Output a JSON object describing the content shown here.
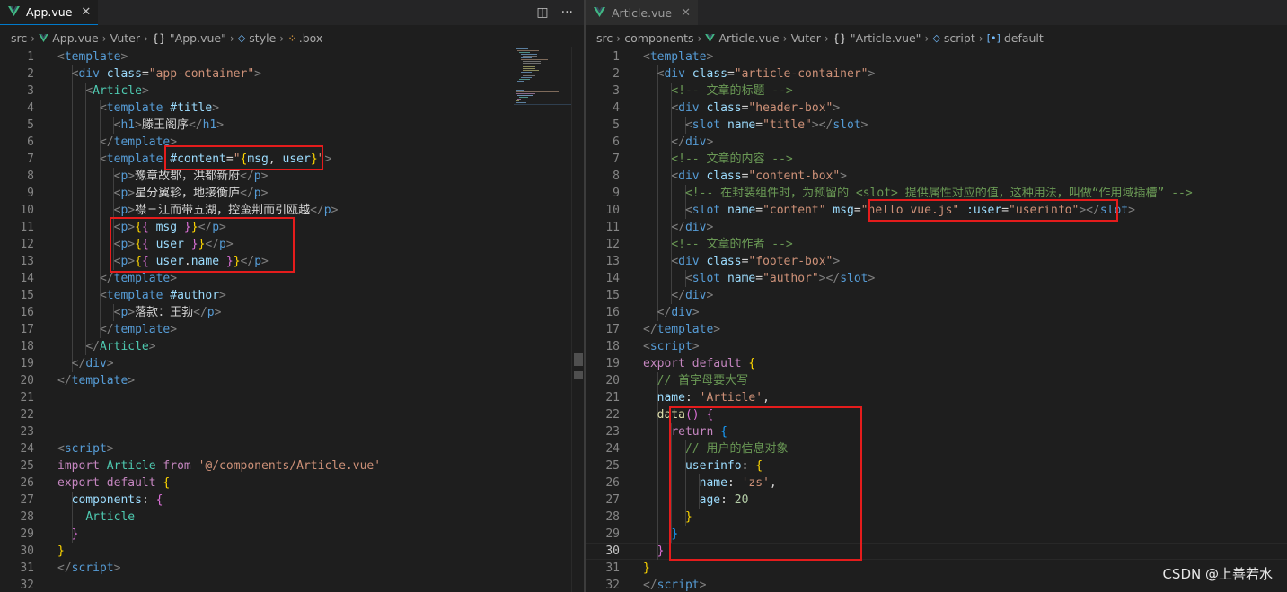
{
  "left_editor": {
    "tab": {
      "label": "App.vue",
      "close": "✕"
    },
    "actions": {
      "split": "◫",
      "more": "···"
    },
    "breadcrumb": [
      "src",
      "App.vue",
      "Vuter",
      "\"App.vue\"",
      "style",
      ".box"
    ],
    "lines": [
      [
        [
          "t",
          "<"
        ],
        [
          "tg",
          "template"
        ],
        [
          "t",
          ">"
        ]
      ],
      [
        [
          "tx",
          "  "
        ],
        [
          "t",
          "<"
        ],
        [
          "tg",
          "div"
        ],
        [
          "tx",
          " "
        ],
        [
          "at",
          "class"
        ],
        [
          "tx",
          "="
        ],
        [
          "st",
          "\"app-container\""
        ],
        [
          "t",
          ">"
        ]
      ],
      [
        [
          "tx",
          "    "
        ],
        [
          "t",
          "<"
        ],
        [
          "cl",
          "Article"
        ],
        [
          "t",
          ">"
        ]
      ],
      [
        [
          "tx",
          "      "
        ],
        [
          "t",
          "<"
        ],
        [
          "tg",
          "template"
        ],
        [
          "tx",
          " "
        ],
        [
          "at",
          "#title"
        ],
        [
          "t",
          ">"
        ]
      ],
      [
        [
          "tx",
          "        "
        ],
        [
          "t",
          "<"
        ],
        [
          "tg",
          "h1"
        ],
        [
          "t",
          ">"
        ],
        [
          "tx",
          "滕王阁序"
        ],
        [
          "t",
          "</"
        ],
        [
          "tg",
          "h1"
        ],
        [
          "t",
          ">"
        ]
      ],
      [
        [
          "tx",
          "      "
        ],
        [
          "t",
          "</"
        ],
        [
          "tg",
          "template"
        ],
        [
          "t",
          ">"
        ]
      ],
      [
        [
          "tx",
          "      "
        ],
        [
          "t",
          "<"
        ],
        [
          "tg",
          "template"
        ],
        [
          "tx",
          " "
        ],
        [
          "at",
          "#content"
        ],
        [
          "tx",
          "="
        ],
        [
          "st",
          "\""
        ],
        [
          "b1",
          "{"
        ],
        [
          "vr",
          "msg"
        ],
        [
          "tx",
          ", "
        ],
        [
          "vr",
          "user"
        ],
        [
          "b1",
          "}"
        ],
        [
          "st",
          "\""
        ],
        [
          "t",
          ">"
        ]
      ],
      [
        [
          "tx",
          "        "
        ],
        [
          "t",
          "<"
        ],
        [
          "tg",
          "p"
        ],
        [
          "t",
          ">"
        ],
        [
          "tx",
          "豫章故郡，洪都新府"
        ],
        [
          "t",
          "</"
        ],
        [
          "tg",
          "p"
        ],
        [
          "t",
          ">"
        ]
      ],
      [
        [
          "tx",
          "        "
        ],
        [
          "t",
          "<"
        ],
        [
          "tg",
          "p"
        ],
        [
          "t",
          ">"
        ],
        [
          "tx",
          "星分翼轸，地接衡庐"
        ],
        [
          "t",
          "</"
        ],
        [
          "tg",
          "p"
        ],
        [
          "t",
          ">"
        ]
      ],
      [
        [
          "tx",
          "        "
        ],
        [
          "t",
          "<"
        ],
        [
          "tg",
          "p"
        ],
        [
          "t",
          ">"
        ],
        [
          "tx",
          "襟三江而带五湖，控蛮荆而引瓯越"
        ],
        [
          "t",
          "</"
        ],
        [
          "tg",
          "p"
        ],
        [
          "t",
          ">"
        ]
      ],
      [
        [
          "tx",
          "        "
        ],
        [
          "t",
          "<"
        ],
        [
          "tg",
          "p"
        ],
        [
          "t",
          ">"
        ],
        [
          "b1",
          "{"
        ],
        [
          "b2",
          "{"
        ],
        [
          "tx",
          " "
        ],
        [
          "vr",
          "msg"
        ],
        [
          "tx",
          " "
        ],
        [
          "b2",
          "}"
        ],
        [
          "b1",
          "}"
        ],
        [
          "t",
          "</"
        ],
        [
          "tg",
          "p"
        ],
        [
          "t",
          ">"
        ]
      ],
      [
        [
          "tx",
          "        "
        ],
        [
          "t",
          "<"
        ],
        [
          "tg",
          "p"
        ],
        [
          "t",
          ">"
        ],
        [
          "b1",
          "{"
        ],
        [
          "b2",
          "{"
        ],
        [
          "tx",
          " "
        ],
        [
          "vr",
          "user"
        ],
        [
          "tx",
          " "
        ],
        [
          "b2",
          "}"
        ],
        [
          "b1",
          "}"
        ],
        [
          "t",
          "</"
        ],
        [
          "tg",
          "p"
        ],
        [
          "t",
          ">"
        ]
      ],
      [
        [
          "tx",
          "        "
        ],
        [
          "t",
          "<"
        ],
        [
          "tg",
          "p"
        ],
        [
          "t",
          ">"
        ],
        [
          "b1",
          "{"
        ],
        [
          "b2",
          "{"
        ],
        [
          "tx",
          " "
        ],
        [
          "vr",
          "user"
        ],
        [
          "tx",
          "."
        ],
        [
          "vr",
          "name"
        ],
        [
          "tx",
          " "
        ],
        [
          "b2",
          "}"
        ],
        [
          "b1",
          "}"
        ],
        [
          "t",
          "</"
        ],
        [
          "tg",
          "p"
        ],
        [
          "t",
          ">"
        ]
      ],
      [
        [
          "tx",
          "      "
        ],
        [
          "t",
          "</"
        ],
        [
          "tg",
          "template"
        ],
        [
          "t",
          ">"
        ]
      ],
      [
        [
          "tx",
          "      "
        ],
        [
          "t",
          "<"
        ],
        [
          "tg",
          "template"
        ],
        [
          "tx",
          " "
        ],
        [
          "at",
          "#author"
        ],
        [
          "t",
          ">"
        ]
      ],
      [
        [
          "tx",
          "        "
        ],
        [
          "t",
          "<"
        ],
        [
          "tg",
          "p"
        ],
        [
          "t",
          ">"
        ],
        [
          "tx",
          "落款：王勃"
        ],
        [
          "t",
          "</"
        ],
        [
          "tg",
          "p"
        ],
        [
          "t",
          ">"
        ]
      ],
      [
        [
          "tx",
          "      "
        ],
        [
          "t",
          "</"
        ],
        [
          "tg",
          "template"
        ],
        [
          "t",
          ">"
        ]
      ],
      [
        [
          "tx",
          "    "
        ],
        [
          "t",
          "</"
        ],
        [
          "cl",
          "Article"
        ],
        [
          "t",
          ">"
        ]
      ],
      [
        [
          "tx",
          "  "
        ],
        [
          "t",
          "</"
        ],
        [
          "tg",
          "div"
        ],
        [
          "t",
          ">"
        ]
      ],
      [
        [
          "t",
          "</"
        ],
        [
          "tg",
          "template"
        ],
        [
          "t",
          ">"
        ]
      ],
      [],
      [],
      [],
      [
        [
          "t",
          "<"
        ],
        [
          "tg",
          "script"
        ],
        [
          "t",
          ">"
        ]
      ],
      [
        [
          "kw",
          "import"
        ],
        [
          "tx",
          " "
        ],
        [
          "cl",
          "Article"
        ],
        [
          "tx",
          " "
        ],
        [
          "kw",
          "from"
        ],
        [
          "tx",
          " "
        ],
        [
          "st",
          "'@/components/Article.vue'"
        ]
      ],
      [
        [
          "kw",
          "export"
        ],
        [
          "tx",
          " "
        ],
        [
          "kw",
          "default"
        ],
        [
          "tx",
          " "
        ],
        [
          "b1",
          "{"
        ]
      ],
      [
        [
          "tx",
          "  "
        ],
        [
          "vr",
          "components"
        ],
        [
          "tx",
          ": "
        ],
        [
          "b2",
          "{"
        ]
      ],
      [
        [
          "tx",
          "    "
        ],
        [
          "cl",
          "Article"
        ]
      ],
      [
        [
          "tx",
          "  "
        ],
        [
          "b2",
          "}"
        ]
      ],
      [
        [
          "b1",
          "}"
        ]
      ],
      [
        [
          "t",
          "</"
        ],
        [
          "tg",
          "script"
        ],
        [
          "t",
          ">"
        ]
      ],
      []
    ]
  },
  "right_editor": {
    "tab": {
      "label": "Article.vue",
      "close": "✕"
    },
    "breadcrumb": [
      "src",
      "components",
      "Article.vue",
      "Vuter",
      "\"Article.vue\"",
      "script",
      "default"
    ],
    "current_line": 30,
    "lines": [
      [
        [
          "t",
          "<"
        ],
        [
          "tg",
          "template"
        ],
        [
          "t",
          ">"
        ]
      ],
      [
        [
          "tx",
          "  "
        ],
        [
          "t",
          "<"
        ],
        [
          "tg",
          "div"
        ],
        [
          "tx",
          " "
        ],
        [
          "at",
          "class"
        ],
        [
          "tx",
          "="
        ],
        [
          "st",
          "\"article-container\""
        ],
        [
          "t",
          ">"
        ]
      ],
      [
        [
          "tx",
          "    "
        ],
        [
          "cm",
          "<!-- 文章的标题 -->"
        ]
      ],
      [
        [
          "tx",
          "    "
        ],
        [
          "t",
          "<"
        ],
        [
          "tg",
          "div"
        ],
        [
          "tx",
          " "
        ],
        [
          "at",
          "class"
        ],
        [
          "tx",
          "="
        ],
        [
          "st",
          "\"header-box\""
        ],
        [
          "t",
          ">"
        ]
      ],
      [
        [
          "tx",
          "      "
        ],
        [
          "t",
          "<"
        ],
        [
          "tg",
          "slot"
        ],
        [
          "tx",
          " "
        ],
        [
          "at",
          "name"
        ],
        [
          "tx",
          "="
        ],
        [
          "st",
          "\"title\""
        ],
        [
          "t",
          "></"
        ],
        [
          "tg",
          "slot"
        ],
        [
          "t",
          ">"
        ]
      ],
      [
        [
          "tx",
          "    "
        ],
        [
          "t",
          "</"
        ],
        [
          "tg",
          "div"
        ],
        [
          "t",
          ">"
        ]
      ],
      [
        [
          "tx",
          "    "
        ],
        [
          "cm",
          "<!-- 文章的内容 -->"
        ]
      ],
      [
        [
          "tx",
          "    "
        ],
        [
          "t",
          "<"
        ],
        [
          "tg",
          "div"
        ],
        [
          "tx",
          " "
        ],
        [
          "at",
          "class"
        ],
        [
          "tx",
          "="
        ],
        [
          "st",
          "\"content-box\""
        ],
        [
          "t",
          ">"
        ]
      ],
      [
        [
          "tx",
          "      "
        ],
        [
          "cm",
          "<!-- 在封装组件时，为预留的 <slot> 提供属性对应的值，这种用法，叫做“作用域插槽” -->"
        ]
      ],
      [
        [
          "tx",
          "      "
        ],
        [
          "t",
          "<"
        ],
        [
          "tg",
          "slot"
        ],
        [
          "tx",
          " "
        ],
        [
          "at",
          "name"
        ],
        [
          "tx",
          "="
        ],
        [
          "st",
          "\"content\""
        ],
        [
          "tx",
          " "
        ],
        [
          "at",
          "msg"
        ],
        [
          "tx",
          "="
        ],
        [
          "st",
          "\"hello vue.js\""
        ],
        [
          "tx",
          " "
        ],
        [
          "at",
          ":user"
        ],
        [
          "tx",
          "="
        ],
        [
          "st",
          "\"userinfo\""
        ],
        [
          "t",
          "></"
        ],
        [
          "tg",
          "slot"
        ],
        [
          "t",
          ">"
        ]
      ],
      [
        [
          "tx",
          "    "
        ],
        [
          "t",
          "</"
        ],
        [
          "tg",
          "div"
        ],
        [
          "t",
          ">"
        ]
      ],
      [
        [
          "tx",
          "    "
        ],
        [
          "cm",
          "<!-- 文章的作者 -->"
        ]
      ],
      [
        [
          "tx",
          "    "
        ],
        [
          "t",
          "<"
        ],
        [
          "tg",
          "div"
        ],
        [
          "tx",
          " "
        ],
        [
          "at",
          "class"
        ],
        [
          "tx",
          "="
        ],
        [
          "st",
          "\"footer-box\""
        ],
        [
          "t",
          ">"
        ]
      ],
      [
        [
          "tx",
          "      "
        ],
        [
          "t",
          "<"
        ],
        [
          "tg",
          "slot"
        ],
        [
          "tx",
          " "
        ],
        [
          "at",
          "name"
        ],
        [
          "tx",
          "="
        ],
        [
          "st",
          "\"author\""
        ],
        [
          "t",
          "></"
        ],
        [
          "tg",
          "slot"
        ],
        [
          "t",
          ">"
        ]
      ],
      [
        [
          "tx",
          "    "
        ],
        [
          "t",
          "</"
        ],
        [
          "tg",
          "div"
        ],
        [
          "t",
          ">"
        ]
      ],
      [
        [
          "tx",
          "  "
        ],
        [
          "t",
          "</"
        ],
        [
          "tg",
          "div"
        ],
        [
          "t",
          ">"
        ]
      ],
      [
        [
          "t",
          "</"
        ],
        [
          "tg",
          "template"
        ],
        [
          "t",
          ">"
        ]
      ],
      [
        [
          "t",
          "<"
        ],
        [
          "tg",
          "script"
        ],
        [
          "t",
          ">"
        ]
      ],
      [
        [
          "kw",
          "export"
        ],
        [
          "tx",
          " "
        ],
        [
          "kw",
          "default"
        ],
        [
          "tx",
          " "
        ],
        [
          "b1",
          "{"
        ]
      ],
      [
        [
          "tx",
          "  "
        ],
        [
          "cm",
          "// 首字母要大写"
        ]
      ],
      [
        [
          "tx",
          "  "
        ],
        [
          "vr",
          "name"
        ],
        [
          "tx",
          ": "
        ],
        [
          "st",
          "'Article'"
        ],
        [
          "tx",
          ","
        ]
      ],
      [
        [
          "tx",
          "  "
        ],
        [
          "fn",
          "data"
        ],
        [
          "b2",
          "()"
        ],
        [
          "tx",
          " "
        ],
        [
          "b2",
          "{"
        ]
      ],
      [
        [
          "tx",
          "    "
        ],
        [
          "kw",
          "return"
        ],
        [
          "tx",
          " "
        ],
        [
          "b3",
          "{"
        ]
      ],
      [
        [
          "tx",
          "      "
        ],
        [
          "cm",
          "// 用户的信息对象"
        ]
      ],
      [
        [
          "tx",
          "      "
        ],
        [
          "vr",
          "userinfo"
        ],
        [
          "tx",
          ": "
        ],
        [
          "b1",
          "{"
        ]
      ],
      [
        [
          "tx",
          "        "
        ],
        [
          "vr",
          "name"
        ],
        [
          "tx",
          ": "
        ],
        [
          "st",
          "'zs'"
        ],
        [
          "tx",
          ","
        ]
      ],
      [
        [
          "tx",
          "        "
        ],
        [
          "vr",
          "age"
        ],
        [
          "tx",
          ": "
        ],
        [
          "nm",
          "20"
        ]
      ],
      [
        [
          "tx",
          "      "
        ],
        [
          "b1",
          "}"
        ]
      ],
      [
        [
          "tx",
          "    "
        ],
        [
          "b3",
          "}"
        ]
      ],
      [
        [
          "tx",
          "  "
        ],
        [
          "b2",
          "}"
        ]
      ],
      [
        [
          "b1",
          "}"
        ]
      ],
      [
        [
          "t",
          "</"
        ],
        [
          "tg",
          "script"
        ],
        [
          "t",
          ">"
        ]
      ]
    ]
  },
  "watermark": "CSDN @上善若水",
  "colors": {
    "highlight_box": "#e51c1c",
    "active_tab_border": "#007acc",
    "background": "#1e1e1e"
  }
}
